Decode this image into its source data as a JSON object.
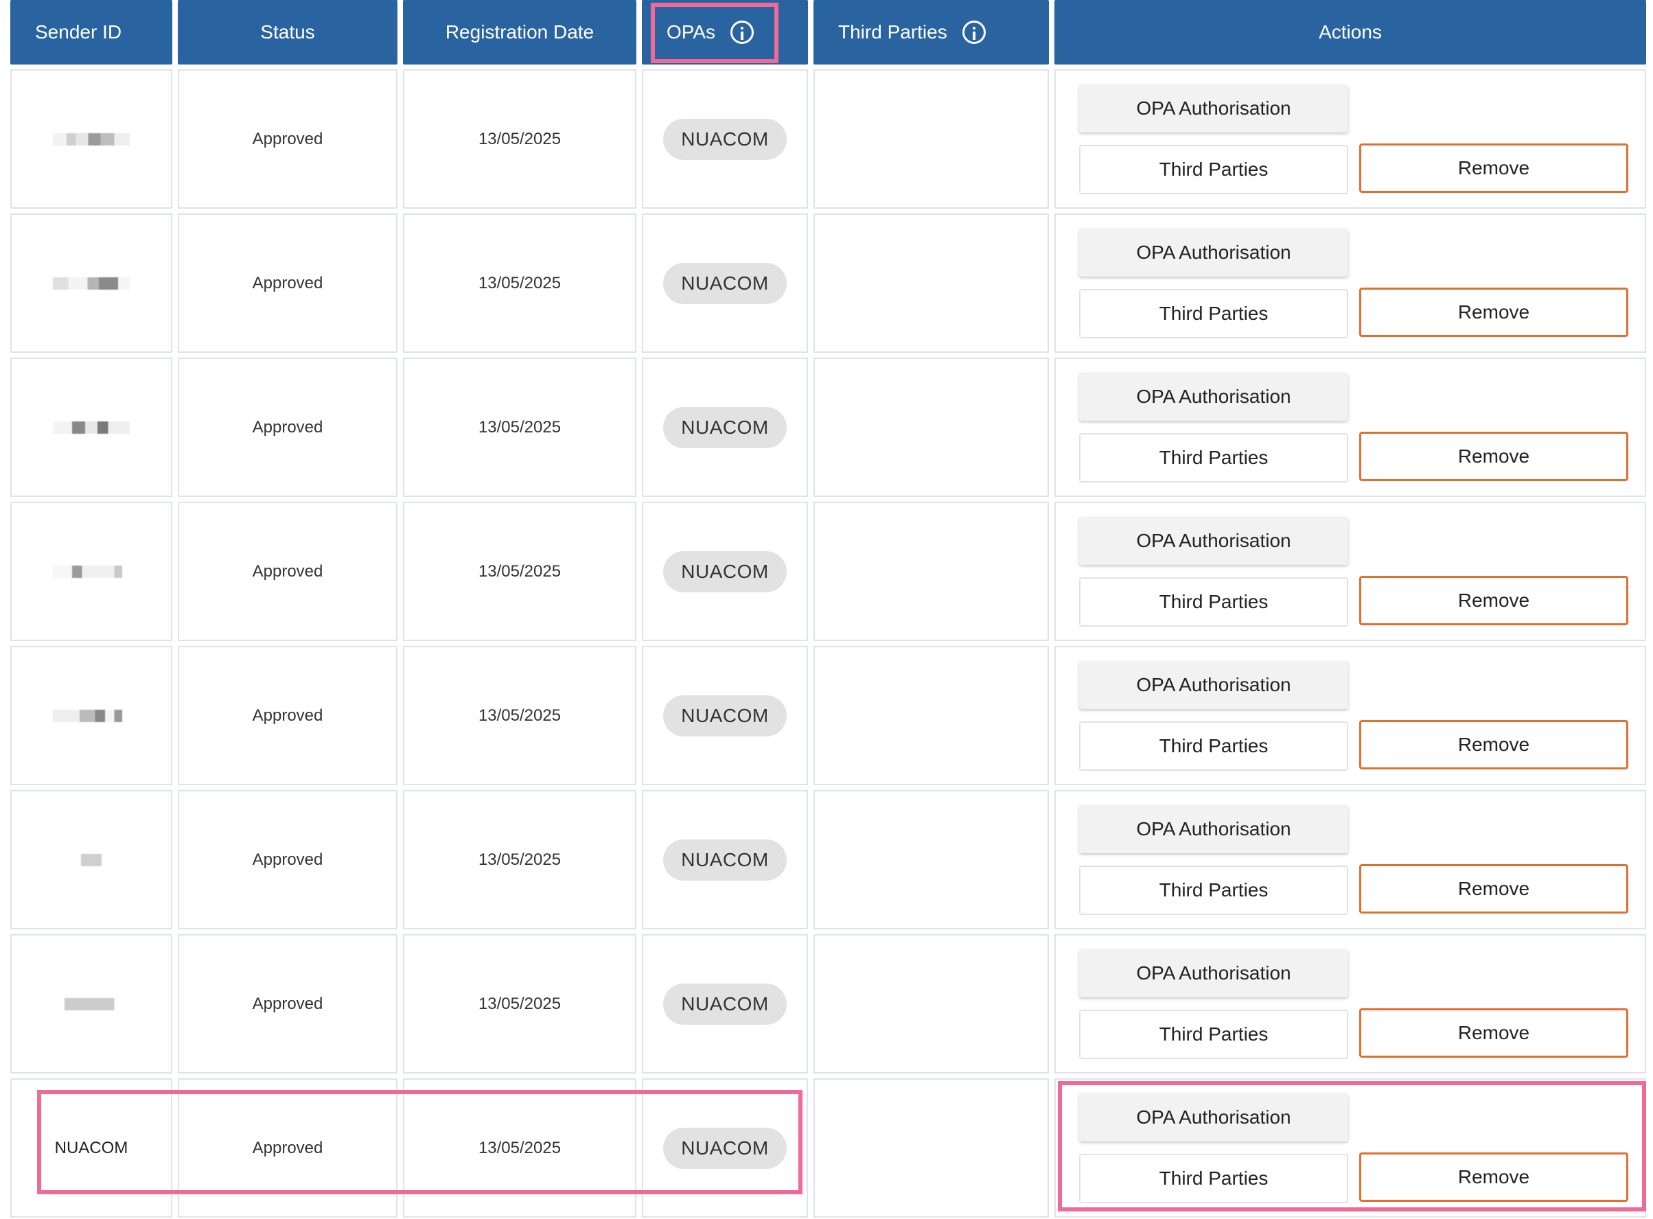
{
  "headers": {
    "sender_id": "Sender ID",
    "status": "Status",
    "registration_date": "Registration Date",
    "opas": "OPAs",
    "third_parties": "Third Parties",
    "actions": "Actions"
  },
  "buttons": {
    "opa_authorisation": "OPA Authorisation",
    "third_parties": "Third Parties",
    "remove": "Remove"
  },
  "rows": [
    {
      "sender_id": "",
      "status": "Approved",
      "registration_date": "13/05/2025",
      "opa": "NUACOM",
      "third_parties": ""
    },
    {
      "sender_id": "",
      "status": "Approved",
      "registration_date": "13/05/2025",
      "opa": "NUACOM",
      "third_parties": ""
    },
    {
      "sender_id": "",
      "status": "Approved",
      "registration_date": "13/05/2025",
      "opa": "NUACOM",
      "third_parties": ""
    },
    {
      "sender_id": "",
      "status": "Approved",
      "registration_date": "13/05/2025",
      "opa": "NUACOM",
      "third_parties": ""
    },
    {
      "sender_id": "",
      "status": "Approved",
      "registration_date": "13/05/2025",
      "opa": "NUACOM",
      "third_parties": ""
    },
    {
      "sender_id": "",
      "status": "Approved",
      "registration_date": "13/05/2025",
      "opa": "NUACOM",
      "third_parties": ""
    },
    {
      "sender_id": "",
      "status": "Approved",
      "registration_date": "13/05/2025",
      "opa": "NUACOM",
      "third_parties": ""
    },
    {
      "sender_id": "NUACOM",
      "status": "Approved",
      "registration_date": "13/05/2025",
      "opa": "NUACOM",
      "third_parties": ""
    }
  ],
  "colors": {
    "header_bg": "#2a64a0",
    "highlight": "#ef6a94",
    "remove_border": "#e07030",
    "chip_bg": "#e2e2e2"
  },
  "icons": [
    "info-icon"
  ]
}
